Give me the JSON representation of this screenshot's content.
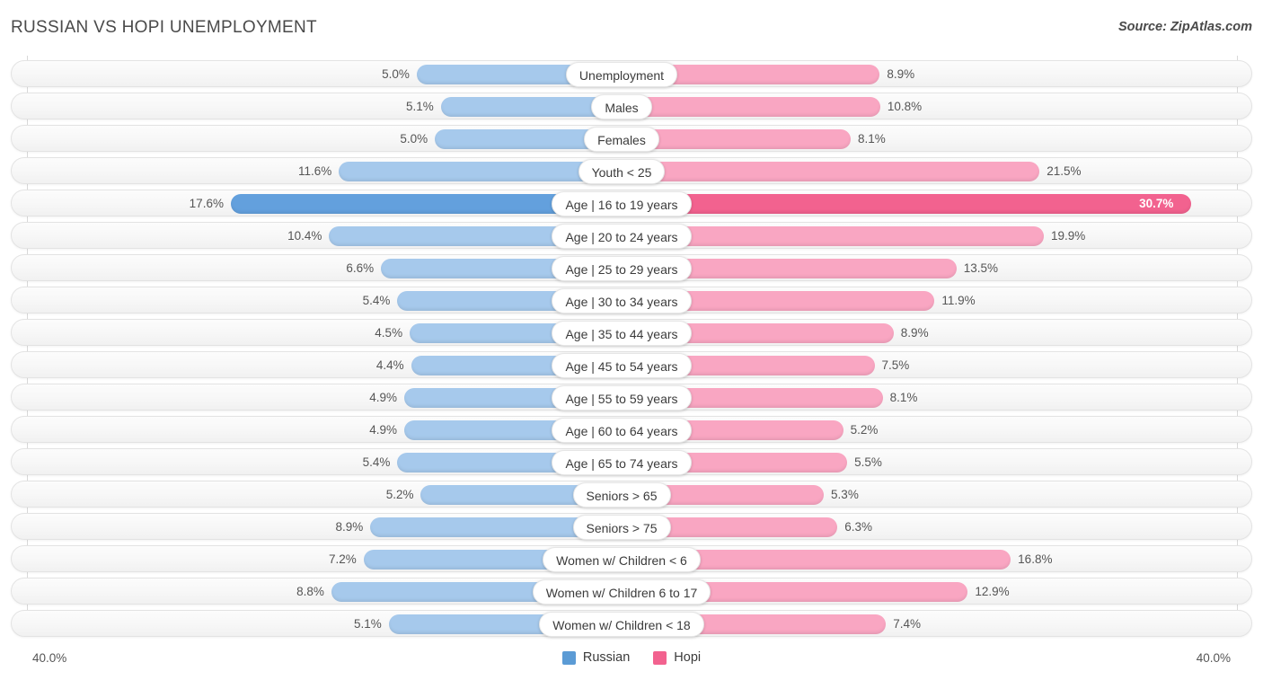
{
  "header": {
    "title": "RUSSIAN VS HOPI UNEMPLOYMENT",
    "source": "Source: ZipAtlas.com"
  },
  "axis": {
    "left_label": "40.0%",
    "right_label": "40.0%"
  },
  "legend": {
    "items": [
      {
        "label": "Russian",
        "color": "#5b9bd5",
        "icon": "blue-square-swatch"
      },
      {
        "label": "Hopi",
        "color": "#f2628f",
        "icon": "pink-square-swatch"
      }
    ]
  },
  "colors": {
    "russian_normal": "#a6c9ec",
    "russian_highlight": "#63a0dd",
    "hopi_normal": "#f9a6c2",
    "hopi_highlight": "#f2628f",
    "row_track": "#f7f7f7",
    "row_border": "#e3e3e3",
    "gridline": "#d8d8d8",
    "text": "#555555"
  },
  "chart_data": {
    "type": "bar",
    "subtype": "diverging-bidirectional-bar",
    "title": "RUSSIAN VS HOPI UNEMPLOYMENT",
    "xlabel": "",
    "ylabel": "",
    "xlim": [
      40.0,
      40.0
    ],
    "axis_max_percent": 40.0,
    "grid": true,
    "legend_position": "bottom-center",
    "categories": [
      "Unemployment",
      "Males",
      "Females",
      "Youth < 25",
      "Age | 16 to 19 years",
      "Age | 20 to 24 years",
      "Age | 25 to 29 years",
      "Age | 30 to 34 years",
      "Age | 35 to 44 years",
      "Age | 45 to 54 years",
      "Age | 55 to 59 years",
      "Age | 60 to 64 years",
      "Age | 65 to 74 years",
      "Seniors > 65",
      "Seniors > 75",
      "Women w/ Children < 6",
      "Women w/ Children 6 to 17",
      "Women w/ Children < 18"
    ],
    "series": [
      {
        "name": "Russian",
        "direction": "left",
        "color": "#a6c9ec",
        "values": [
          5.0,
          5.1,
          5.0,
          11.6,
          17.6,
          10.4,
          6.6,
          5.4,
          4.5,
          4.4,
          4.9,
          4.9,
          5.4,
          5.2,
          8.9,
          7.2,
          8.8,
          5.1
        ],
        "labels": [
          "5.0%",
          "5.1%",
          "5.0%",
          "11.6%",
          "17.6%",
          "10.4%",
          "6.6%",
          "5.4%",
          "4.5%",
          "4.4%",
          "4.9%",
          "4.9%",
          "5.4%",
          "5.2%",
          "8.9%",
          "7.2%",
          "8.8%",
          "5.1%"
        ]
      },
      {
        "name": "Hopi",
        "direction": "right",
        "color": "#f9a6c2",
        "values": [
          8.9,
          10.8,
          8.1,
          21.5,
          30.7,
          19.9,
          13.5,
          11.9,
          8.9,
          7.5,
          8.1,
          5.2,
          5.5,
          5.3,
          6.3,
          16.8,
          12.9,
          7.4
        ],
        "labels": [
          "8.9%",
          "10.8%",
          "8.1%",
          "21.5%",
          "30.7%",
          "19.9%",
          "13.5%",
          "11.9%",
          "8.9%",
          "7.5%",
          "8.1%",
          "5.2%",
          "5.5%",
          "5.3%",
          "6.3%",
          "16.8%",
          "12.9%",
          "7.4%"
        ]
      }
    ],
    "highlighted_row_index": 4,
    "highlighted_row_category": "Age | 16 to 19 years",
    "highlighted_value_label_inside_bar": "30.7%"
  },
  "rows": [
    {
      "label": "Unemployment",
      "left_label": "5.0%",
      "right_label": "8.9%",
      "left_value": 5.0,
      "right_value": 8.9,
      "highlight": false
    },
    {
      "label": "Males",
      "left_label": "5.1%",
      "right_label": "10.8%",
      "left_value": 5.1,
      "right_value": 10.8,
      "highlight": false
    },
    {
      "label": "Females",
      "left_label": "5.0%",
      "right_label": "8.1%",
      "left_value": 5.0,
      "right_value": 8.1,
      "highlight": false
    },
    {
      "label": "Youth < 25",
      "left_label": "11.6%",
      "right_label": "21.5%",
      "left_value": 11.6,
      "right_value": 21.5,
      "highlight": false
    },
    {
      "label": "Age | 16 to 19 years",
      "left_label": "17.6%",
      "right_label": "30.7%",
      "left_value": 17.6,
      "right_value": 30.7,
      "highlight": true
    },
    {
      "label": "Age | 20 to 24 years",
      "left_label": "10.4%",
      "right_label": "19.9%",
      "left_value": 10.4,
      "right_value": 19.9,
      "highlight": false
    },
    {
      "label": "Age | 25 to 29 years",
      "left_label": "6.6%",
      "right_label": "13.5%",
      "left_value": 6.6,
      "right_value": 13.5,
      "highlight": false
    },
    {
      "label": "Age | 30 to 34 years",
      "left_label": "5.4%",
      "right_label": "11.9%",
      "left_value": 5.4,
      "right_value": 11.9,
      "highlight": false
    },
    {
      "label": "Age | 35 to 44 years",
      "left_label": "4.5%",
      "right_label": "8.9%",
      "left_value": 4.5,
      "right_value": 8.9,
      "highlight": false
    },
    {
      "label": "Age | 45 to 54 years",
      "left_label": "4.4%",
      "right_label": "7.5%",
      "left_value": 4.4,
      "right_value": 7.5,
      "highlight": false
    },
    {
      "label": "Age | 55 to 59 years",
      "left_label": "4.9%",
      "right_label": "8.1%",
      "left_value": 4.9,
      "right_value": 8.1,
      "highlight": false
    },
    {
      "label": "Age | 60 to 64 years",
      "left_label": "4.9%",
      "right_label": "5.2%",
      "left_value": 4.9,
      "right_value": 5.2,
      "highlight": false
    },
    {
      "label": "Age | 65 to 74 years",
      "left_label": "5.4%",
      "right_label": "5.5%",
      "left_value": 5.4,
      "right_value": 5.5,
      "highlight": false
    },
    {
      "label": "Seniors > 65",
      "left_label": "5.2%",
      "right_label": "5.3%",
      "left_value": 5.2,
      "right_value": 5.3,
      "highlight": false
    },
    {
      "label": "Seniors > 75",
      "left_label": "8.9%",
      "right_label": "6.3%",
      "left_value": 8.9,
      "right_value": 6.3,
      "highlight": false
    },
    {
      "label": "Women w/ Children < 6",
      "left_label": "7.2%",
      "right_label": "16.8%",
      "left_value": 7.2,
      "right_value": 16.8,
      "highlight": false
    },
    {
      "label": "Women w/ Children 6 to 17",
      "left_label": "8.8%",
      "right_label": "12.9%",
      "left_value": 8.8,
      "right_value": 12.9,
      "highlight": false
    },
    {
      "label": "Women w/ Children < 18",
      "left_label": "5.1%",
      "right_label": "7.4%",
      "left_value": 5.1,
      "right_value": 7.4,
      "highlight": false
    }
  ]
}
